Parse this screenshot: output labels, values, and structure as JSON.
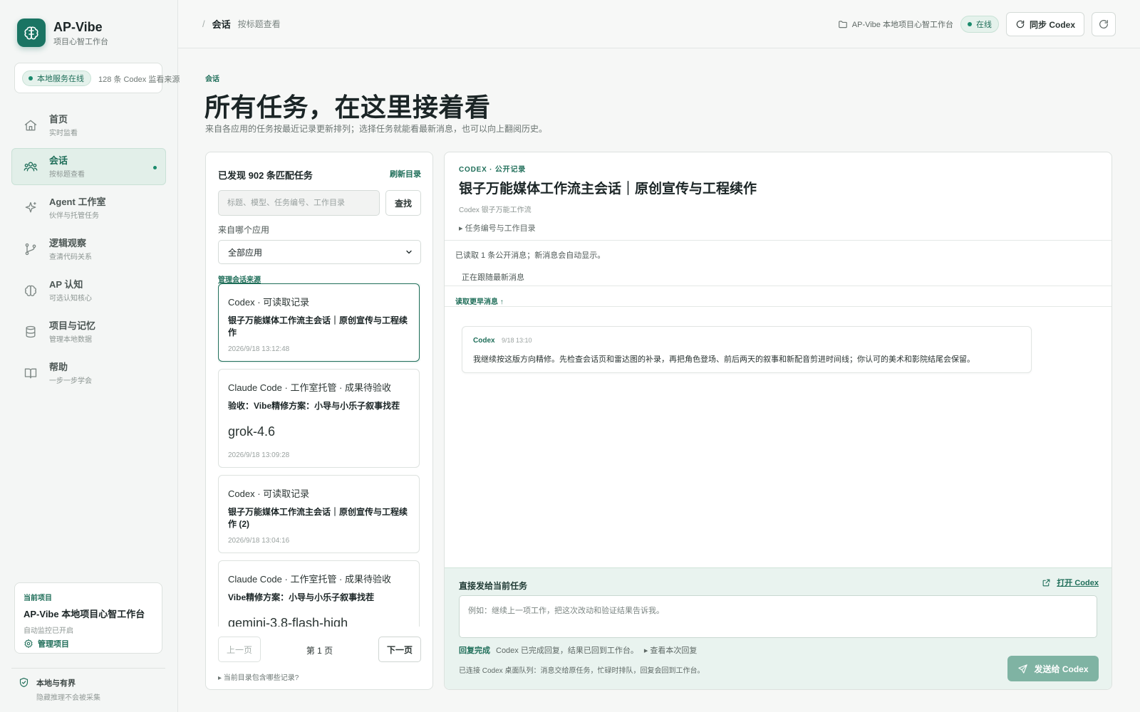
{
  "brand": {
    "name": "AP-Vibe",
    "subtitle": "项目心智工作台"
  },
  "status": {
    "pill": "本地服务在线",
    "count": "128 条 Codex 监看来源"
  },
  "nav": [
    {
      "label": "首页",
      "sub": "实时监看",
      "icon": "home-icon"
    },
    {
      "label": "会话",
      "sub": "按标题查看",
      "icon": "users-icon",
      "active": true
    },
    {
      "label": "Agent 工作室",
      "sub": "伙伴与托管任务",
      "icon": "sparkle-icon"
    },
    {
      "label": "逻辑观察",
      "sub": "查清代码关系",
      "icon": "git-branch-icon"
    },
    {
      "label": "AP 认知",
      "sub": "可选认知核心",
      "icon": "brain-icon"
    },
    {
      "label": "项目与记忆",
      "sub": "管理本地数据",
      "icon": "database-icon"
    },
    {
      "label": "帮助",
      "sub": "一步一步学会",
      "icon": "book-icon"
    }
  ],
  "project": {
    "kicker": "当前项目",
    "name": "AP-Vibe 本地项目心智工作台",
    "note": "自动监控已开启",
    "manage": "管理项目"
  },
  "privacy": {
    "title": "本地与有界",
    "sub": "隐藏推理不会被采集"
  },
  "topbar": {
    "separator": "/",
    "crumb": "会话",
    "crumb_sub": "按标题查看",
    "workspace": "AP-Vibe 本地项目心智工作台",
    "online": "在线",
    "sync": "同步 Codex"
  },
  "page": {
    "kicker": "会话",
    "title": "所有任务，在这里接着看",
    "desc": "来自各应用的任务按最近记录更新排列；选择任务就能看最新消息，也可以向上翻阅历史。"
  },
  "tasks": {
    "found": "已发现 902 条匹配任务",
    "refresh": "刷新目录",
    "search_placeholder": "标题、模型、任务编号、工作目录",
    "search_btn": "查找",
    "source_label": "来自哪个应用",
    "source_value": "全部应用",
    "manage_link": "管理会话来源",
    "items": [
      {
        "source": "Codex · 可读取记录",
        "title": "银子万能媒体工作流主会话｜原创宣传与工程续作",
        "model": "",
        "time": "2026/9/18 13:12:48",
        "selected": true
      },
      {
        "source": "Claude Code · 工作室托管 · 成果待验收",
        "title": "验收：Vibe精修方案：小导与小乐子叙事找茬",
        "model": "grok-4.6",
        "time": "2026/9/18 13:09:28"
      },
      {
        "source": "Codex · 可读取记录",
        "title": "银子万能媒体工作流主会话｜原创宣传与工程续作 (2)",
        "model": "",
        "time": "2026/9/18 13:04:16"
      },
      {
        "source": "Claude Code · 工作室托管 · 成果待验收",
        "title": "Vibe精修方案：小导与小乐子叙事找茬",
        "model": "gemini-3.8-flash-high",
        "time": ""
      }
    ],
    "prev": "上一页",
    "page": "第 1 页",
    "next": "下一页",
    "dir_note": "▸ 当前目录包含哪些记录?"
  },
  "detail": {
    "kicker": "CODEX · 公开记录",
    "title": "银子万能媒体工作流主会话｜原创宣传与工程续作",
    "sub": "Codex 银子万能工作流",
    "toggle": "▸ 任务编号与工作目录",
    "read_status": "已读取 1 条公开消息；新消息会自动显示。",
    "following": "正在跟随最新消息",
    "older": "读取更早消息 ↑",
    "message": {
      "author": "Codex",
      "time": "9/18 13:10",
      "body": "我继续按这版方向精修。先检查会话页和雷达图的补录，再把角色登场、前后两天的叙事和新配音剪进时间线；你认可的美术和影院结尾会保留。"
    }
  },
  "composer": {
    "title": "直接发给当前任务",
    "open": "打开 Codex",
    "placeholder": "例如：继续上一项工作，把这次改动和验证结果告诉我。",
    "done": "回复完成",
    "done_msg": "Codex 已完成回复，结果已回到工作台。",
    "view": "▸ 查看本次回复",
    "queue": "已连接 Codex 桌面队列：消息交给原任务，忙碌时排队，回复会回到工作台。",
    "send": "发送给 Codex"
  },
  "colors": {
    "accent": "#1f6e59",
    "brand": "#1a7463",
    "send_btn": "#7fb3a3"
  }
}
